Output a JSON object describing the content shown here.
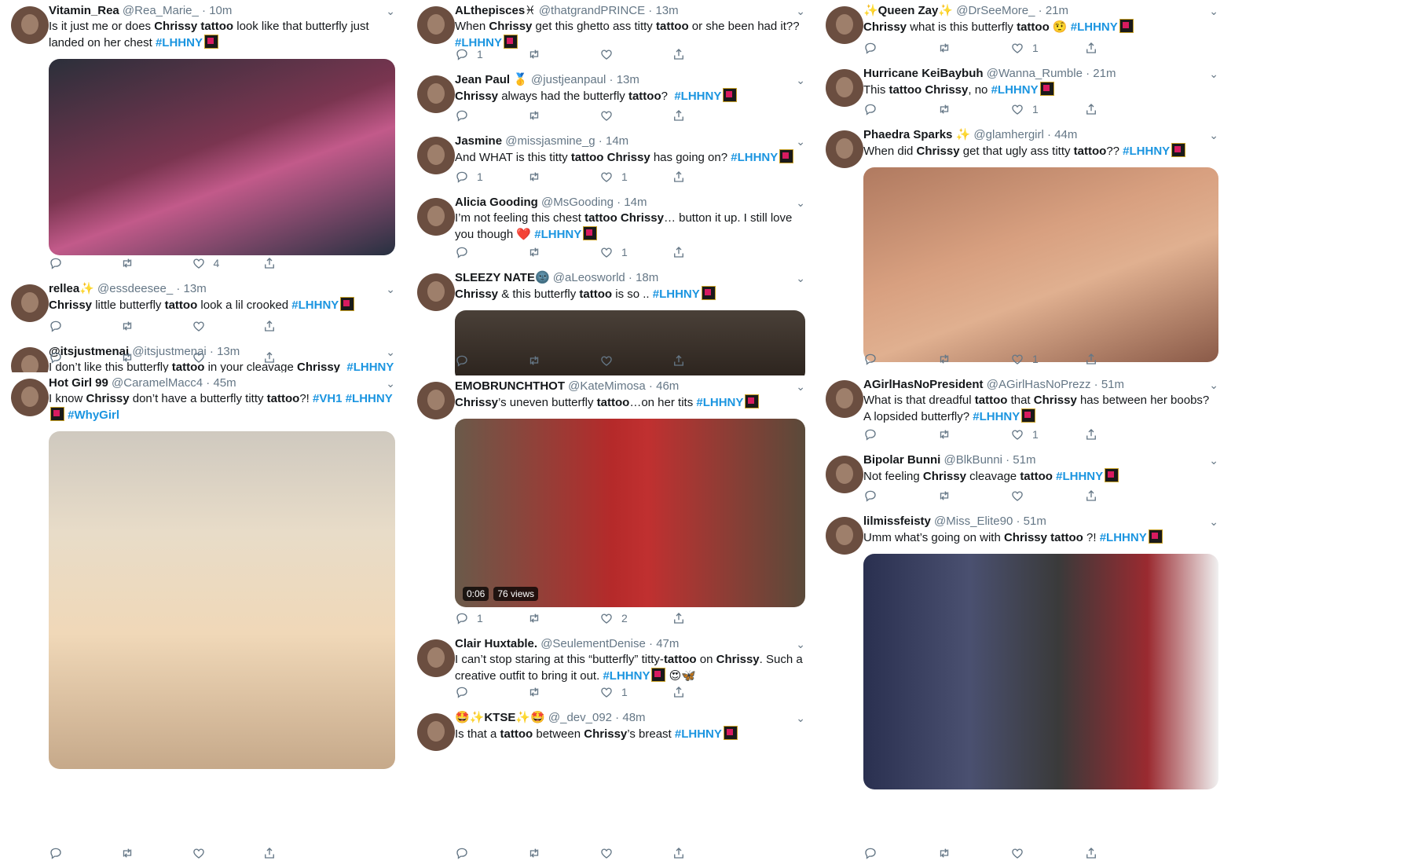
{
  "hashtag": "#LHHNY",
  "columns": [
    [
      {
        "name": "Vitamin_Rea",
        "handle": "@Rea_Marie_",
        "time": "10m",
        "parts": [
          [
            "t",
            "Is it just me or does "
          ],
          [
            "b",
            "Chrissy tattoo"
          ],
          [
            "t",
            " look like that butterfly just landed on her chest "
          ],
          [
            "h",
            "#LHHNY"
          ]
        ],
        "counts": [
          "",
          "",
          "4",
          ""
        ],
        "media": "photo-woman-shocked"
      },
      {
        "name": "rellea✨",
        "handle": "@essdeesee_",
        "time": "13m",
        "parts": [
          [
            "b",
            "Chrissy"
          ],
          [
            "t",
            " little butterfly "
          ],
          [
            "b",
            "tattoo"
          ],
          [
            "t",
            " look a lil crooked "
          ],
          [
            "h",
            "#LHHNY"
          ]
        ],
        "counts": [
          "",
          "",
          "",
          ""
        ]
      },
      {
        "name": "@itsjustmenai",
        "handle": "@itsjustmenai",
        "time": "13m",
        "parts": [
          [
            "t",
            "I don’t like this butterfly "
          ],
          [
            "b",
            "tattoo"
          ],
          [
            "t",
            " in your cleavage "
          ],
          [
            "b",
            "Chrissy"
          ],
          [
            "t",
            "  "
          ],
          [
            "h",
            "#LHHNY"
          ]
        ],
        "counts": [
          "",
          "",
          "",
          ""
        ]
      },
      {
        "name": "Hot Girl 99",
        "handle": "@CaramelMacc4",
        "time": "45m",
        "parts": [
          [
            "t",
            "I know "
          ],
          [
            "b",
            "Chrissy"
          ],
          [
            "t",
            " don’t have a butterfly titty "
          ],
          [
            "b",
            "tattoo"
          ],
          [
            "t",
            "?! "
          ],
          [
            "h2",
            "#VH1"
          ],
          [
            "t",
            " "
          ],
          [
            "h",
            "#LHHNY"
          ],
          [
            "t",
            " "
          ],
          [
            "h2",
            "#WhyGirl"
          ]
        ],
        "counts": [
          "",
          "",
          "",
          ""
        ],
        "media": "photo-child"
      }
    ],
    [
      {
        "name": "ALthepisces♓",
        "handle": "@thatgrandPRINCE",
        "time": "13m",
        "parts": [
          [
            "t",
            "When "
          ],
          [
            "b",
            "Chrissy"
          ],
          [
            "t",
            " get this ghetto ass titty "
          ],
          [
            "b",
            "tattoo"
          ],
          [
            "t",
            " or she been had it?? "
          ],
          [
            "h",
            "#LHHNY"
          ]
        ],
        "counts": [
          "1",
          "",
          "",
          ""
        ]
      },
      {
        "name": "Jean Paul 🥇",
        "handle": "@justjeanpaul",
        "time": "13m",
        "parts": [
          [
            "b",
            "Chrissy"
          ],
          [
            "t",
            " always had the butterfly "
          ],
          [
            "b",
            "tattoo"
          ],
          [
            "t",
            "?  "
          ],
          [
            "h",
            "#LHHNY"
          ]
        ],
        "counts": [
          "",
          "",
          "",
          ""
        ]
      },
      {
        "name": "Jasmine",
        "handle": "@missjasmine_g",
        "time": "14m",
        "parts": [
          [
            "t",
            "And WHAT is this titty "
          ],
          [
            "b",
            "tattoo Chrissy"
          ],
          [
            "t",
            " has going on? "
          ],
          [
            "h",
            "#LHHNY"
          ]
        ],
        "counts": [
          "1",
          "",
          "1",
          ""
        ]
      },
      {
        "name": "Alicia Gooding",
        "handle": "@MsGooding",
        "time": "14m",
        "parts": [
          [
            "t",
            "I’m not feeling this chest "
          ],
          [
            "b",
            "tattoo Chrissy"
          ],
          [
            "t",
            "… button it up. I still love you though ❤️ "
          ],
          [
            "h",
            "#LHHNY"
          ]
        ],
        "counts": [
          "",
          "",
          "1",
          ""
        ]
      },
      {
        "name": "SLEEZY NATE🌚",
        "handle": "@aLeosworld",
        "time": "18m",
        "parts": [
          [
            "b",
            "Chrissy"
          ],
          [
            "t",
            " & this butterfly "
          ],
          [
            "b",
            "tattoo"
          ],
          [
            "t",
            " is so .. "
          ],
          [
            "h",
            "#LHHNY"
          ]
        ],
        "counts": [
          "",
          "",
          "",
          ""
        ],
        "media": "photo-partial"
      },
      {
        "name": "EMOBRUNCHTHOT",
        "handle": "@KateMimosa",
        "time": "46m",
        "parts": [
          [
            "b",
            "Chrissy"
          ],
          [
            "t",
            "’s uneven butterfly "
          ],
          [
            "b",
            "tattoo"
          ],
          [
            "t",
            "…on her tits "
          ],
          [
            "h",
            "#LHHNY"
          ]
        ],
        "counts": [
          "1",
          "",
          "2",
          ""
        ],
        "media": "video-red-blouse",
        "video_time": "0:06",
        "video_views": "76 views"
      },
      {
        "name": "Clair Huxtable.",
        "handle": "@SeulementDenise",
        "time": "47m",
        "parts": [
          [
            "t",
            "I can’t stop staring at this “butterfly” titty-"
          ],
          [
            "b",
            "tattoo"
          ],
          [
            "t",
            " on "
          ],
          [
            "b",
            "Chrissy"
          ],
          [
            "t",
            ". Such a creative outfit to bring it out. "
          ],
          [
            "h",
            "#LHHNY"
          ],
          [
            "t",
            " 😍🦋"
          ]
        ],
        "counts": [
          "",
          "",
          "1",
          ""
        ]
      },
      {
        "name": "🤩✨KTSE✨🤩",
        "handle": "@_dev_092",
        "time": "48m",
        "parts": [
          [
            "t",
            "Is that a "
          ],
          [
            "b",
            "tattoo"
          ],
          [
            "t",
            " between "
          ],
          [
            "b",
            "Chrissy"
          ],
          [
            "t",
            "’s breast "
          ],
          [
            "h",
            "#LHHNY"
          ]
        ],
        "counts": [
          "",
          "",
          "",
          ""
        ]
      }
    ],
    [
      {
        "name": "✨Queen Zay✨",
        "handle": "@DrSeeMore_",
        "time": "21m",
        "parts": [
          [
            "b",
            "Chrissy"
          ],
          [
            "t",
            " what is this butterfly "
          ],
          [
            "b",
            "tattoo"
          ],
          [
            "t",
            " 🤨 "
          ],
          [
            "h",
            "#LHHNY"
          ]
        ],
        "counts": [
          "",
          "",
          "1",
          ""
        ]
      },
      {
        "name": "Hurricane KeiBaybuh",
        "handle": "@Wanna_Rumble",
        "time": "21m",
        "parts": [
          [
            "t",
            "This "
          ],
          [
            "b",
            "tattoo Chrissy"
          ],
          [
            "t",
            ", no "
          ],
          [
            "h",
            "#LHHNY"
          ]
        ],
        "counts": [
          "",
          "",
          "1",
          ""
        ]
      },
      {
        "name": "Phaedra Sparks ✨",
        "handle": "@glamhergirl",
        "time": "44m",
        "parts": [
          [
            "t",
            "When did "
          ],
          [
            "b",
            "Chrissy"
          ],
          [
            "t",
            " get that ugly ass titty "
          ],
          [
            "b",
            "tattoo"
          ],
          [
            "t",
            "?? "
          ],
          [
            "h",
            "#LHHNY"
          ]
        ],
        "counts": [
          "",
          "",
          "1",
          ""
        ],
        "media": "photo-closeup"
      },
      {
        "name": "AGirlHasNoPresident",
        "handle": "@AGirlHasNoPrezz",
        "time": "51m",
        "parts": [
          [
            "t",
            "What is that dreadful "
          ],
          [
            "b",
            "tattoo"
          ],
          [
            "t",
            " that "
          ],
          [
            "b",
            "Chrissy"
          ],
          [
            "t",
            " has between her boobs? A lopsided butterfly? "
          ],
          [
            "h",
            "#LHHNY"
          ]
        ],
        "counts": [
          "",
          "",
          "1",
          ""
        ]
      },
      {
        "name": "Bipolar Bunni",
        "handle": "@BlkBunni",
        "time": "51m",
        "parts": [
          [
            "t",
            "Not feeling "
          ],
          [
            "b",
            "Chrissy"
          ],
          [
            "t",
            " cleavage "
          ],
          [
            "b",
            "tattoo"
          ],
          [
            "t",
            " "
          ],
          [
            "h",
            "#LHHNY"
          ]
        ],
        "counts": [
          "",
          "",
          "",
          ""
        ]
      },
      {
        "name": "lilmissfeisty",
        "handle": "@Miss_Elite90",
        "time": "51m",
        "parts": [
          [
            "t",
            "Umm what’s going on with "
          ],
          [
            "b",
            "Chrissy tattoo"
          ],
          [
            "t",
            " ?! "
          ],
          [
            "h",
            "#LHHNY"
          ]
        ],
        "counts": [
          "",
          "",
          "",
          ""
        ],
        "media": "photo-flag"
      }
    ]
  ]
}
